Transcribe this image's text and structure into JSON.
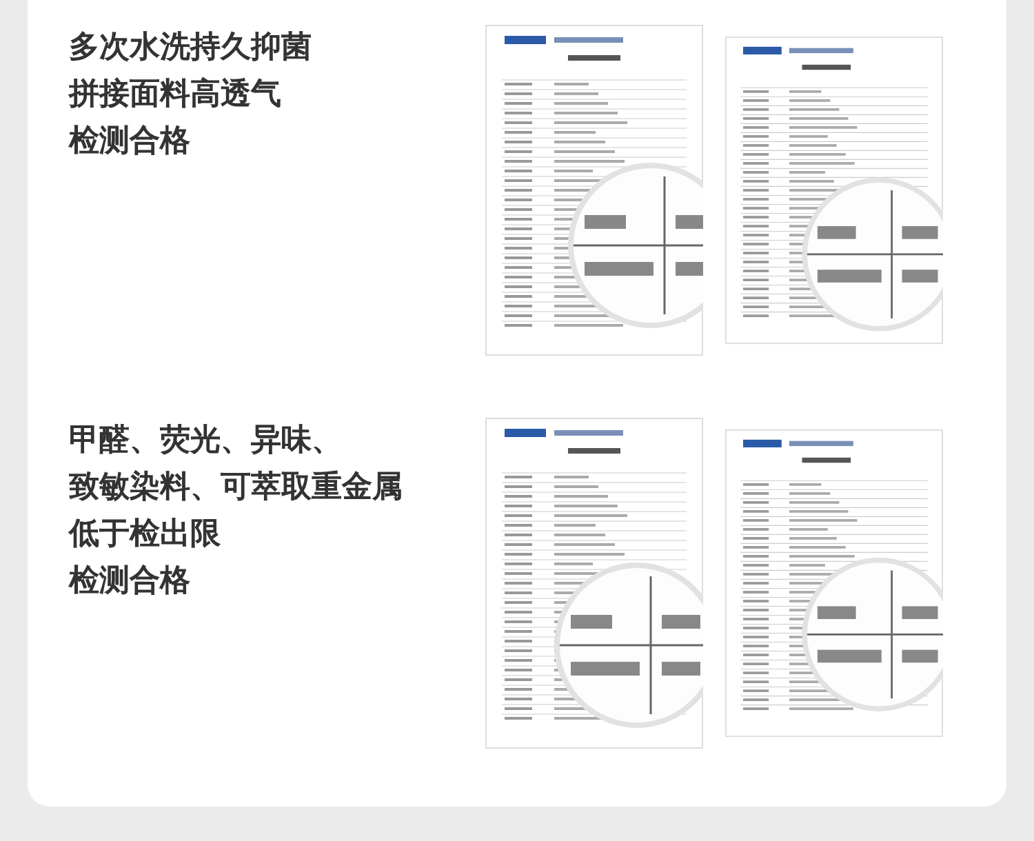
{
  "sections": [
    {
      "lines": [
        "多次水洗持久抑菌",
        "拼接面料高透气",
        "检测合格"
      ]
    },
    {
      "lines": [
        "甲醛、荧光、异味、",
        "致敏染料、可萃取重金属",
        "低于检出限",
        "检测合格"
      ]
    }
  ]
}
